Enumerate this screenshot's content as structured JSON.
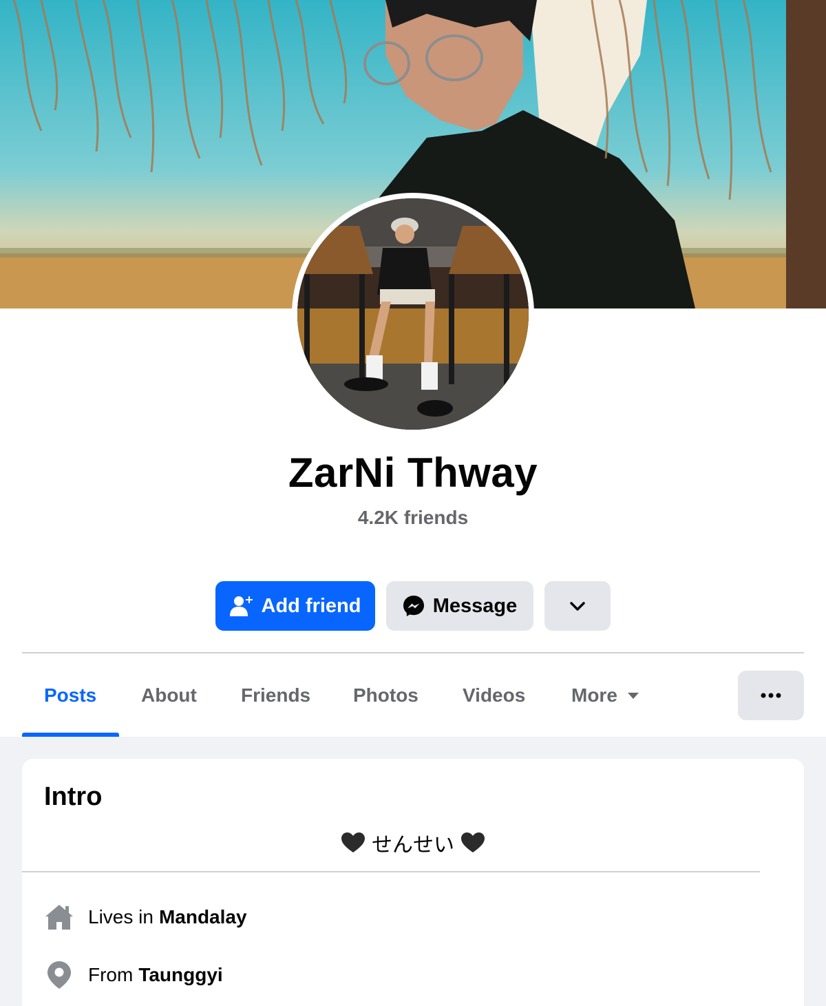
{
  "profile": {
    "name": "ZarNi Thway",
    "friends_count": "4.2K friends"
  },
  "actions": {
    "add_friend_label": "Add friend",
    "message_label": "Message"
  },
  "tabs": [
    {
      "label": "Posts",
      "active": true
    },
    {
      "label": "About",
      "active": false
    },
    {
      "label": "Friends",
      "active": false
    },
    {
      "label": "Photos",
      "active": false
    },
    {
      "label": "Videos",
      "active": false
    },
    {
      "label": "More",
      "active": false
    }
  ],
  "intro": {
    "title": "Intro",
    "bio_text": "せんせい",
    "bio_emoji": "black-heart",
    "lives_in_prefix": "Lives in",
    "lives_in_value": "Mandalay",
    "from_prefix": "From",
    "from_value": "Taunggyi"
  },
  "colors": {
    "primary": "#0866ff",
    "secondary_button": "#e4e6eb",
    "muted_text": "#65676b",
    "page_background": "#f0f2f5"
  },
  "icons": [
    "add-friend-icon",
    "messenger-icon",
    "chevron-down-icon",
    "caret-down-icon",
    "more-dots-icon",
    "home-icon",
    "location-pin-icon",
    "black-heart-icon"
  ]
}
